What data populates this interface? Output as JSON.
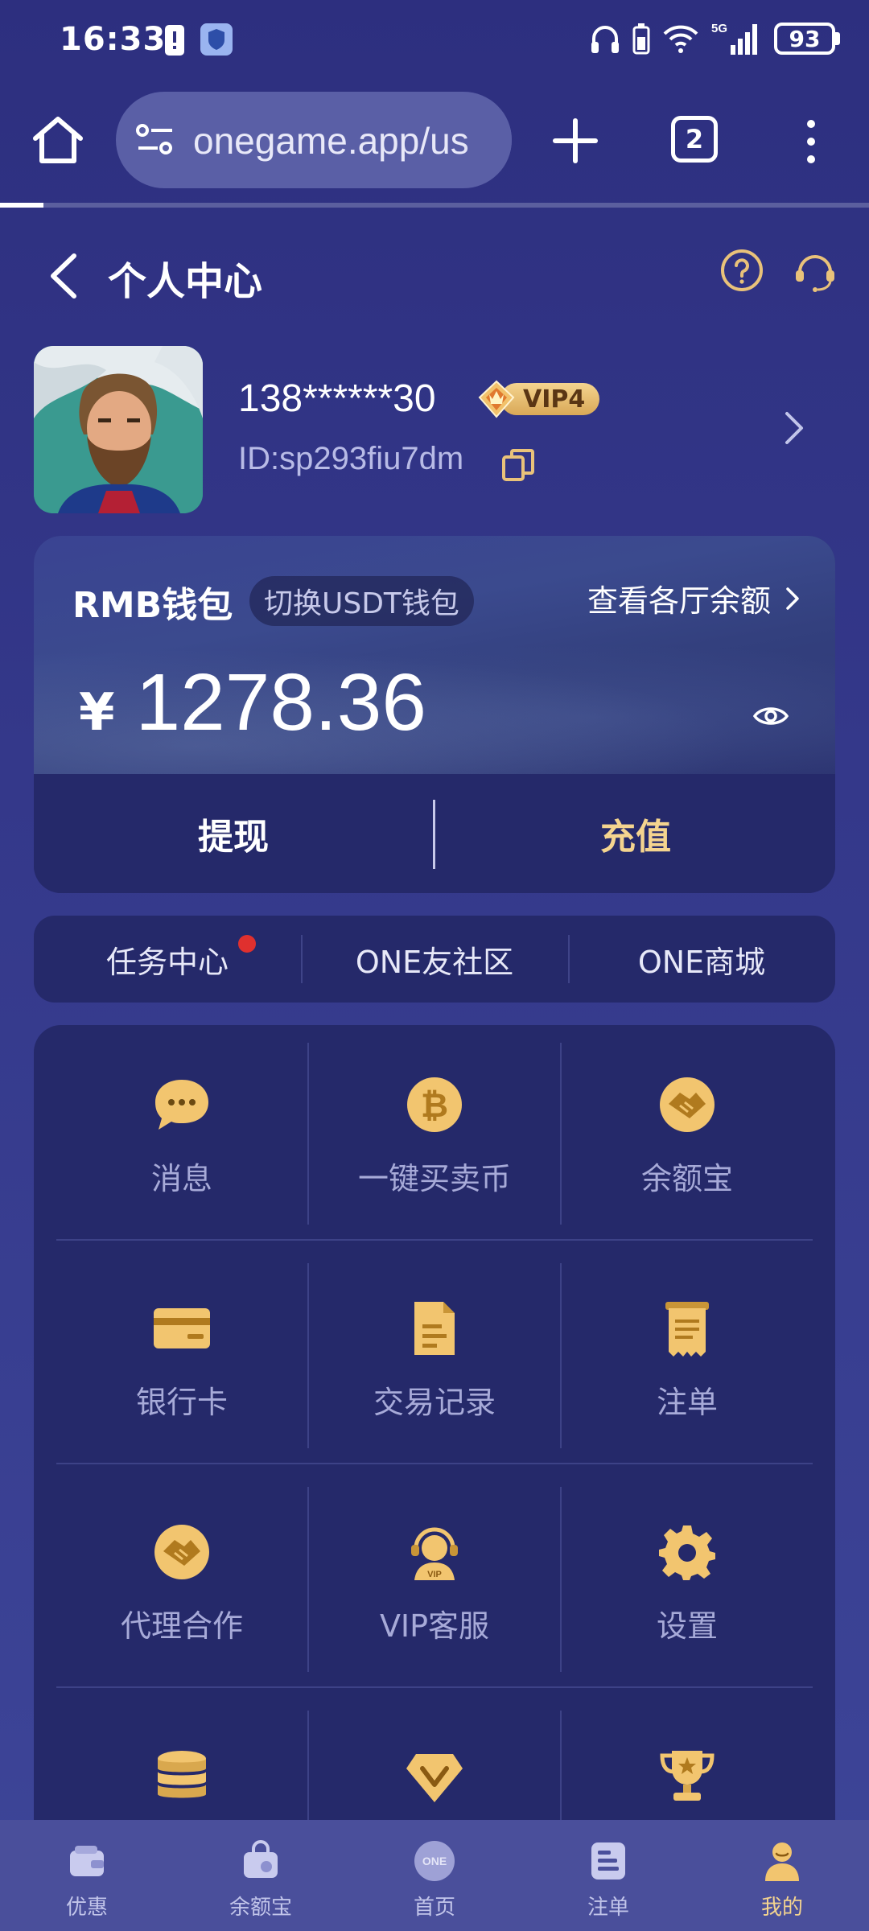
{
  "status_bar": {
    "time": "16:33",
    "battery": "93",
    "network": "5G"
  },
  "browser": {
    "url": "onegame.app/us",
    "tab_count": "2"
  },
  "header": {
    "title": "个人中心"
  },
  "profile": {
    "phone": "138******30",
    "vip": "VIP4",
    "user_id": "ID:sp293fiu7dm"
  },
  "wallet": {
    "name": "RMB钱包",
    "switch_label": "切换USDT钱包",
    "view_all": "查看各厅余额",
    "currency": "¥",
    "balance": "1278.36",
    "withdraw": "提现",
    "deposit": "充值"
  },
  "quick_links": [
    {
      "label": "任务中心",
      "has_dot": true
    },
    {
      "label": "ONE友社区"
    },
    {
      "label": "ONE商城"
    }
  ],
  "grid": [
    {
      "label": "消息",
      "icon": "chat-icon"
    },
    {
      "label": "一键买卖币",
      "icon": "bitcoin-icon"
    },
    {
      "label": "余额宝",
      "icon": "handshake-icon"
    },
    {
      "label": "银行卡",
      "icon": "bank-card-icon"
    },
    {
      "label": "交易记录",
      "icon": "document-icon"
    },
    {
      "label": "注单",
      "icon": "receipt-icon"
    },
    {
      "label": "代理合作",
      "icon": "handshake-icon"
    },
    {
      "label": "VIP客服",
      "icon": "vip-service-icon"
    },
    {
      "label": "设置",
      "icon": "gear-icon"
    },
    {
      "label": "",
      "icon": "coins-icon"
    },
    {
      "label": "",
      "icon": "vip-diamond-icon"
    },
    {
      "label": "",
      "icon": "trophy-icon"
    }
  ],
  "bottom_nav": [
    {
      "label": "优惠",
      "icon": "wallet-icon"
    },
    {
      "label": "余额宝",
      "icon": "bag-icon"
    },
    {
      "label": "首页",
      "icon": "home-logo-icon"
    },
    {
      "label": "注单",
      "icon": "list-icon"
    },
    {
      "label": "我的",
      "icon": "user-icon",
      "active": true
    }
  ],
  "colors": {
    "accent": "#f4d48f",
    "background": "#2d2f7f",
    "card": "#25296a"
  }
}
